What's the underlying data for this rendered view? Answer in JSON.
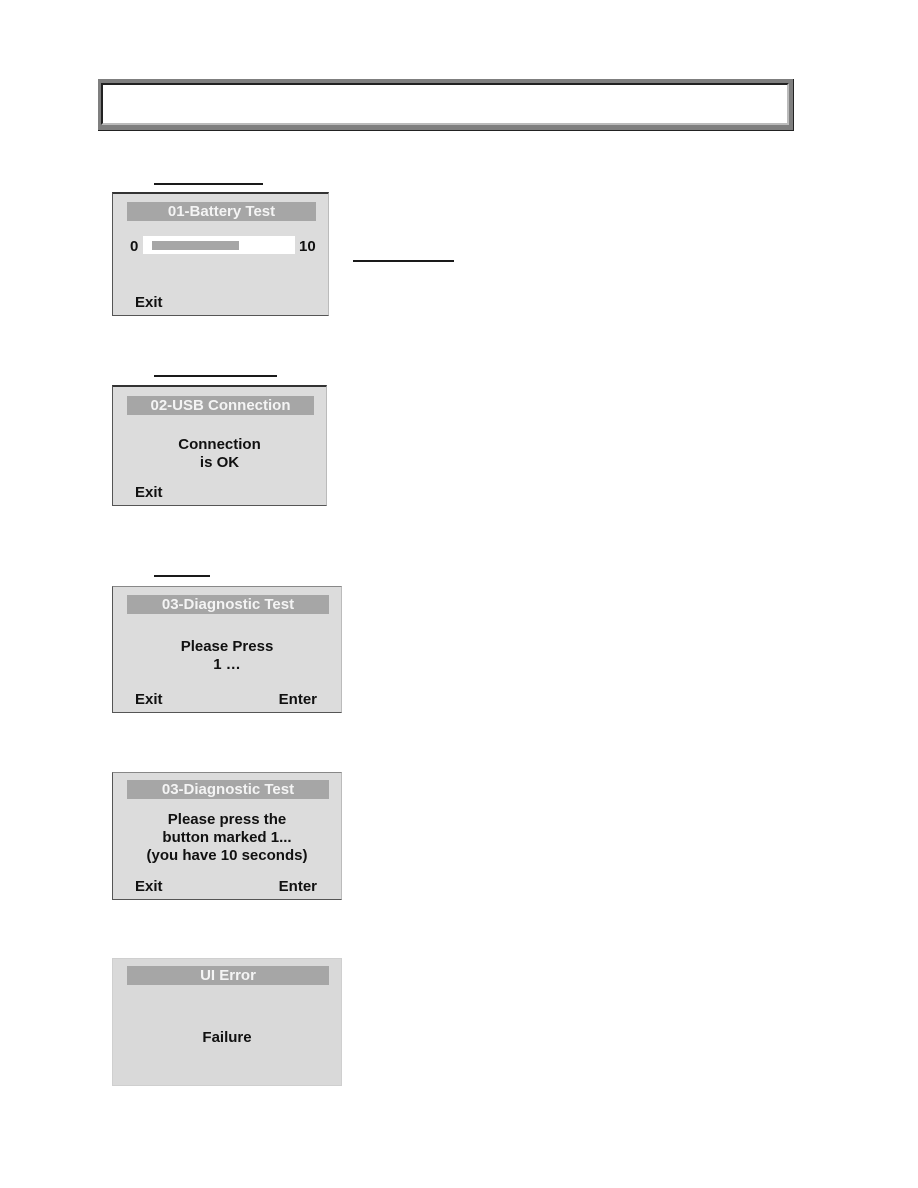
{
  "header": {
    "title": ""
  },
  "screens": [
    {
      "id": "battery-test",
      "title": "01-Battery Test",
      "scale_min": "0",
      "scale_max": "10",
      "battery_level": 6.7,
      "battery_scale_max": 10,
      "soft_left": "Exit"
    },
    {
      "id": "usb-connection",
      "title": "02-USB Connection",
      "lines": [
        "Connection",
        "is OK"
      ],
      "soft_left": "Exit"
    },
    {
      "id": "diagnostic-test-1",
      "title": "03-Diagnostic Test",
      "lines": [
        "Please Press",
        "1 …"
      ],
      "soft_left": "Exit",
      "soft_right": "Enter"
    },
    {
      "id": "diagnostic-test-2",
      "title": "03-Diagnostic Test",
      "lines": [
        "Please press the",
        "button marked 1...",
        "(you have 10 seconds)"
      ],
      "soft_left": "Exit",
      "soft_right": "Enter"
    },
    {
      "id": "ui-error",
      "title": "UI Error",
      "lines": [
        "Failure"
      ]
    }
  ],
  "colors": {
    "title_bar": "#a6a6a6",
    "screen_bg": "#dcdcdc",
    "bar_fill": "#a6a6a6"
  }
}
